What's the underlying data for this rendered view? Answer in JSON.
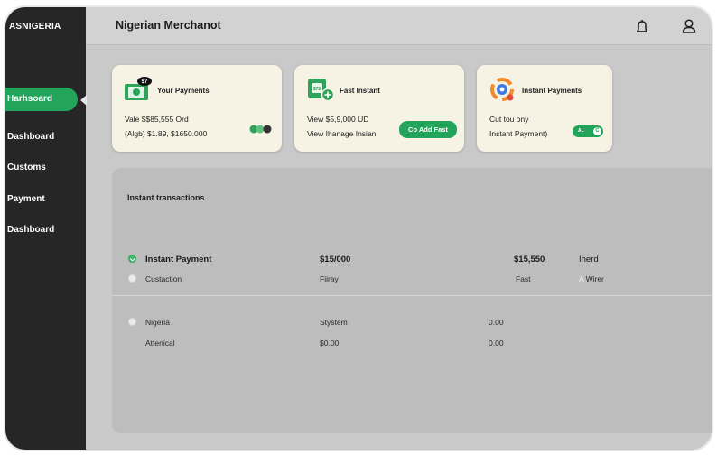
{
  "app": {
    "brand": "ASNIGERIA",
    "title": "Nigerian Merchanot"
  },
  "sidebar": {
    "active": "Harhsoard",
    "items": [
      "Dashboard",
      "Customs",
      "Payment",
      "Dashboard"
    ]
  },
  "cards": [
    {
      "badge": "$7",
      "title": "Your Payments",
      "line1": "Vale $$85,555 Ord",
      "line2": "(Algb) $1.89, $1650.000"
    },
    {
      "badge": "$78",
      "title": "Fast Instant",
      "line1": "View $5,9,000 UD",
      "line2": "View Ihanage Insian",
      "button": "Co Add Fast"
    },
    {
      "title": "Instant Payments",
      "line1": "Cut tou ony",
      "line2": "Instant Payment)",
      "toggle_label": "AL",
      "toggle_knob": "C"
    }
  ],
  "transactions": {
    "title": "Instant transactions",
    "rows": [
      {
        "c1": "Instant Payment",
        "c2": "$15/000",
        "c3": "$15,550",
        "c4": "Iherd",
        "checked": true
      },
      {
        "c1": "Custaction",
        "c2": "Fiiray",
        "c3": "Fast",
        "c4_prefix": "A",
        "c4": "Wirer",
        "checked": false
      },
      {
        "c1": "Nigeria",
        "c2": "Stystem",
        "c3": "0.00",
        "checked": false
      },
      {
        "c1": "Attenical",
        "c2": "$0.00",
        "c3": "0.00"
      }
    ]
  },
  "colors": {
    "accent": "#22a55a",
    "sidebar": "#262626",
    "card": "#f6f2e4",
    "panel": "#bdbdbd"
  }
}
